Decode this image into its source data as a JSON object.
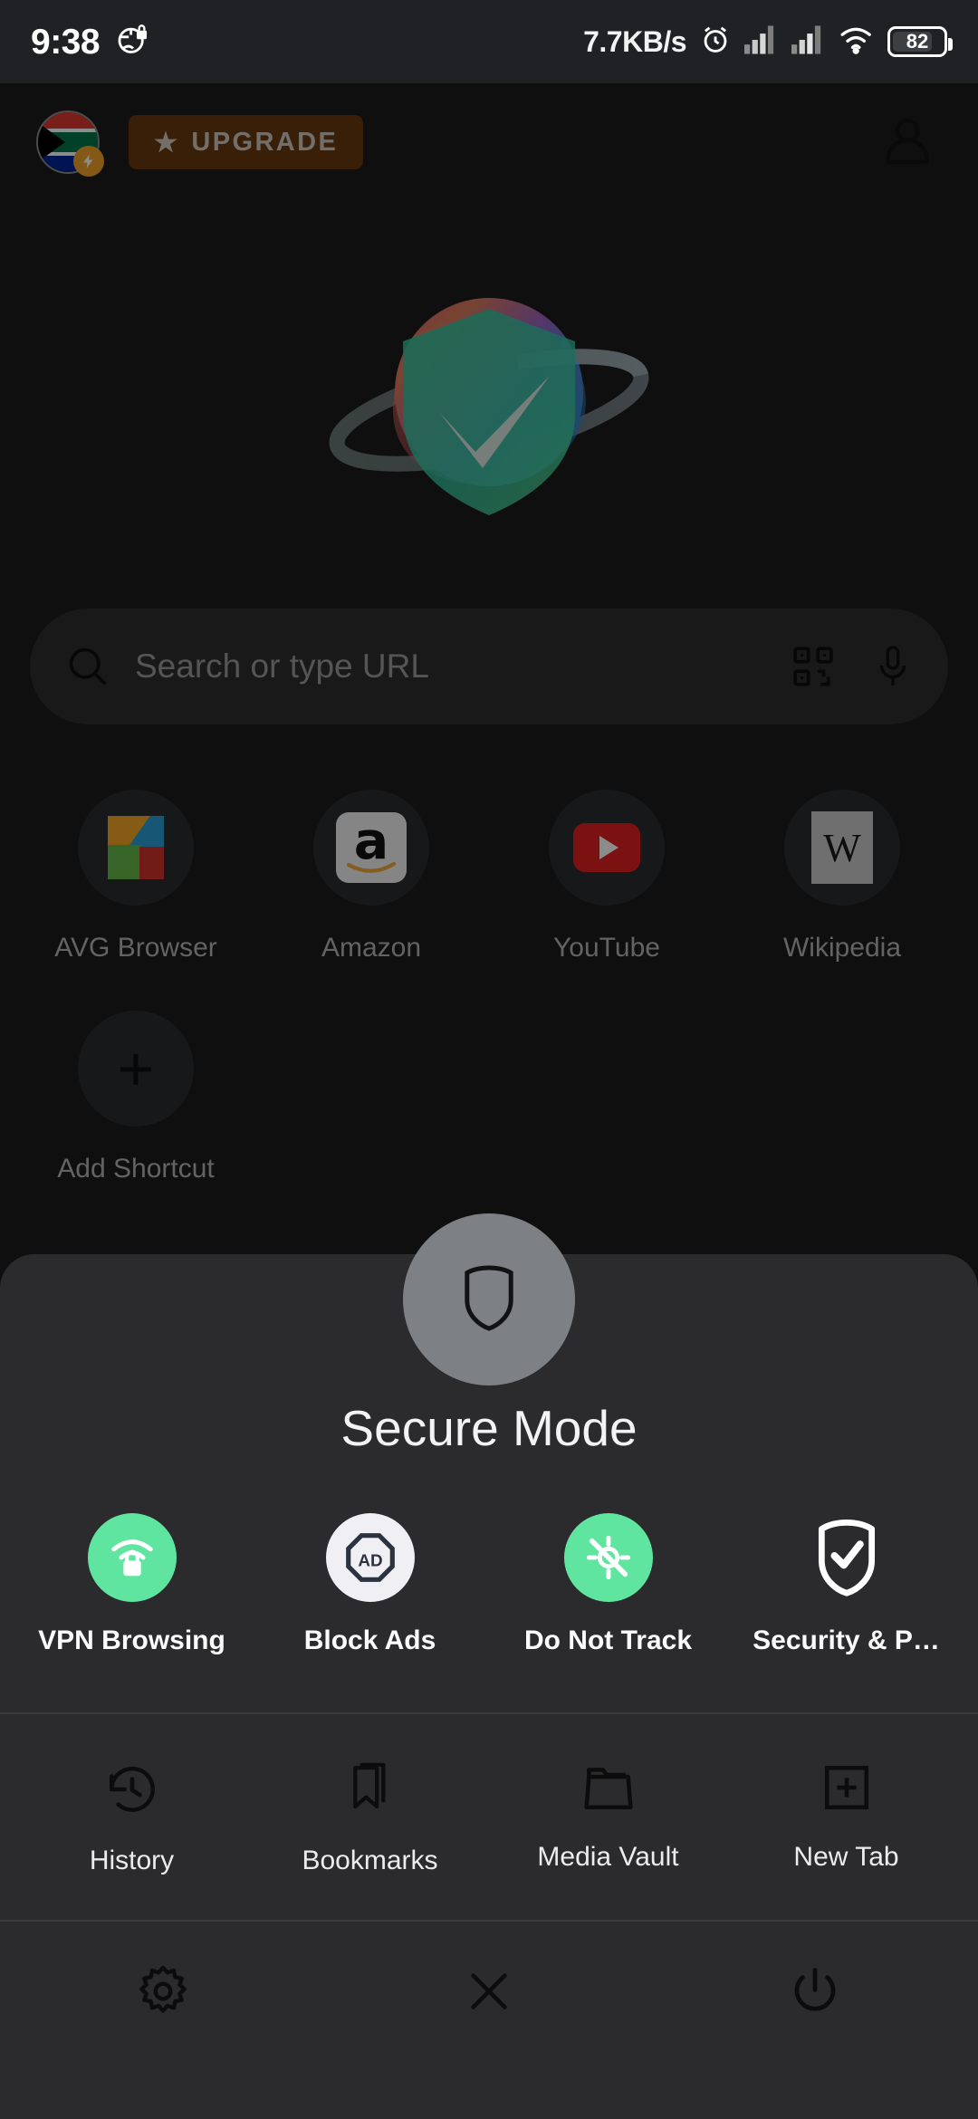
{
  "status_bar": {
    "time": "9:38",
    "vpn_icon": "globe-lock-icon",
    "network_speed": "7.7KB/s",
    "alarm_icon": "alarm-clock-icon",
    "signal_1_icon": "signal-bars-icon",
    "signal_2_icon": "signal-bars-icon",
    "wifi_icon": "wifi-icon",
    "battery_level": "82"
  },
  "top_bar": {
    "flag_icon": "south-africa-flag-icon",
    "bolt_badge_icon": "lightning-bolt-icon",
    "upgrade_label": "UPGRADE",
    "upgrade_star": "★",
    "account_icon": "person-icon"
  },
  "hero": {
    "logo_icon": "planet-shield-checkmark-logo"
  },
  "search": {
    "placeholder": "Search or type URL",
    "search_icon": "search-icon",
    "qr_icon": "qr-code-icon",
    "mic_icon": "microphone-icon"
  },
  "shortcuts": {
    "items": [
      {
        "label": "AVG Browser",
        "icon": "avg-browser-icon"
      },
      {
        "label": "Amazon",
        "icon": "amazon-icon"
      },
      {
        "label": "YouTube",
        "icon": "youtube-icon"
      },
      {
        "label": "Wikipedia",
        "icon": "wikipedia-icon"
      }
    ],
    "add_label": "Add Shortcut",
    "add_icon": "plus-icon"
  },
  "sheet": {
    "fab_icon": "shield-icon",
    "title": "Secure Mode",
    "features": [
      {
        "label": "VPN Browsing",
        "icon": "vpn-lock-icon",
        "style": "green"
      },
      {
        "label": "Block Ads",
        "icon": "ad-block-icon",
        "style": "white"
      },
      {
        "label": "Do Not Track",
        "icon": "do-not-track-icon",
        "style": "green"
      },
      {
        "label": "Security & P…",
        "icon": "shield-check-icon",
        "style": "plain"
      }
    ],
    "actions": [
      {
        "label": "History",
        "icon": "history-clock-icon"
      },
      {
        "label": "Bookmarks",
        "icon": "bookmark-icon"
      },
      {
        "label": "Media Vault",
        "icon": "folder-icon"
      },
      {
        "label": "New Tab",
        "icon": "new-tab-plus-icon"
      }
    ],
    "bottom_bar": [
      {
        "icon": "gear-icon",
        "name": "settings"
      },
      {
        "icon": "close-x-icon",
        "name": "close"
      },
      {
        "icon": "power-icon",
        "name": "exit"
      }
    ]
  },
  "colors": {
    "accent_green": "#5fe5a0",
    "upgrade_bg": "#6b3a0f",
    "sheet_bg": "#2b2b2d",
    "page_bg": "#1c1c1e"
  }
}
